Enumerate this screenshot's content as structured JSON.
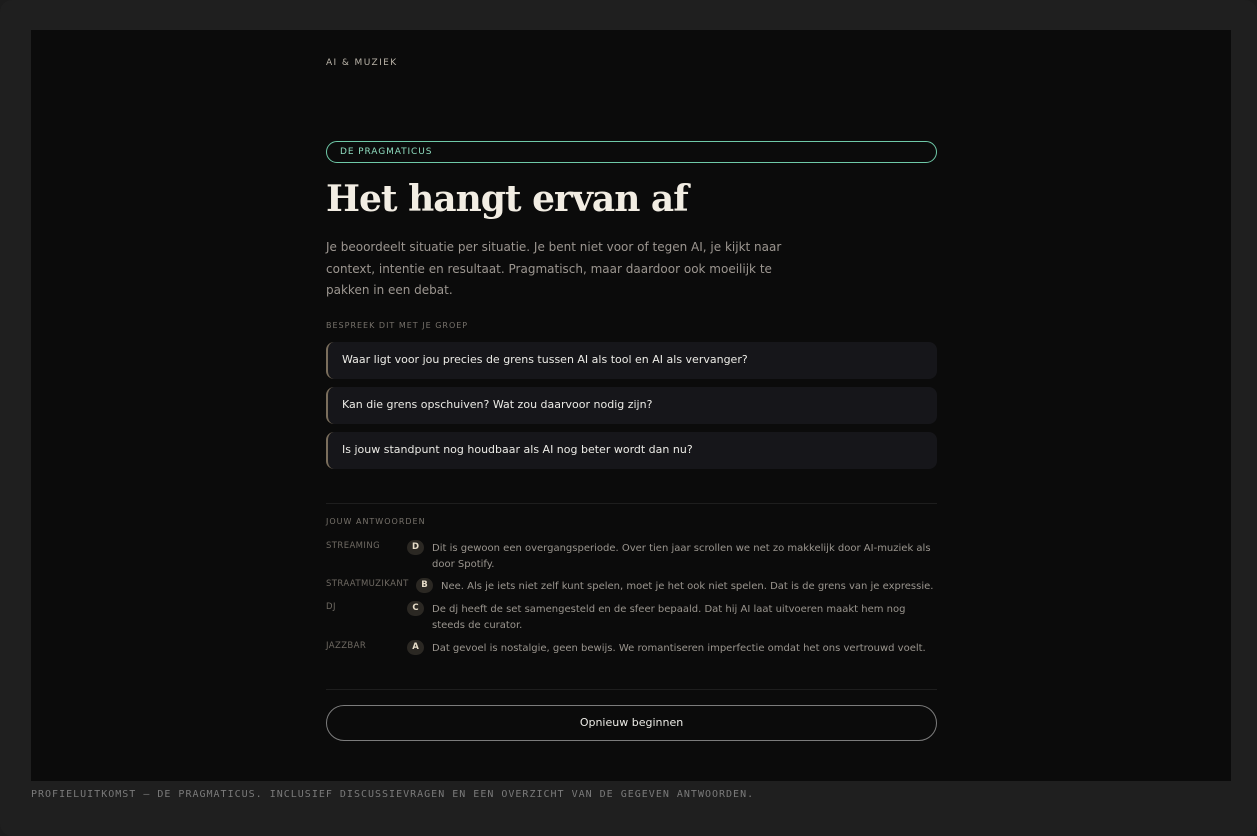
{
  "header": {
    "eyebrow": "AI & MUZIEK"
  },
  "profile": {
    "badge": "DE PRAGMATICUS",
    "title": "Het hangt ervan af",
    "description": "Je beoordeelt situatie per situatie. Je bent niet voor of tegen AI, je kijkt naar context, intentie en resultaat. Pragmatisch, maar daardoor ook moeilijk te pakken in een debat."
  },
  "discussion": {
    "label": "BESPREEK DIT MET JE GROEP",
    "questions": [
      "Waar ligt voor jou precies de grens tussen AI als tool en AI als vervanger?",
      "Kan die grens opschuiven? Wat zou daarvoor nodig zijn?",
      "Is jouw standpunt nog houdbaar als AI nog beter wordt dan nu?"
    ]
  },
  "answers": {
    "label": "JOUW ANTWOORDEN",
    "items": [
      {
        "category": "STREAMING",
        "letter": "D",
        "text": "Dit is gewoon een overgangsperiode. Over tien jaar scrollen we net zo makkelijk door AI-muziek als door Spotify."
      },
      {
        "category": "STRAATMUZIKANT",
        "letter": "B",
        "text": "Nee. Als je iets niet zelf kunt spelen, moet je het ook niet spelen. Dat is de grens van je expressie."
      },
      {
        "category": "DJ",
        "letter": "C",
        "text": "De dj heeft de set samengesteld en de sfeer bepaald. Dat hij AI laat uitvoeren maakt hem nog steeds de curator."
      },
      {
        "category": "JAZZBAR",
        "letter": "A",
        "text": "Dat gevoel is nostalgie, geen bewijs. We romantiseren imperfectie omdat het ons vertrouwd voelt."
      }
    ]
  },
  "actions": {
    "restart_label": "Opnieuw beginnen"
  },
  "caption": "PROFIELUITKOMST — DE PRAGMATICUS. INCLUSIEF DISCUSSIEVRAGEN EN EEN OVERZICHT VAN DE GEGEVEN ANTWOORDEN.",
  "colors": {
    "accent": "#6fc9a8",
    "background": "#0b0b0b",
    "question_border": "#7a6e5c"
  }
}
